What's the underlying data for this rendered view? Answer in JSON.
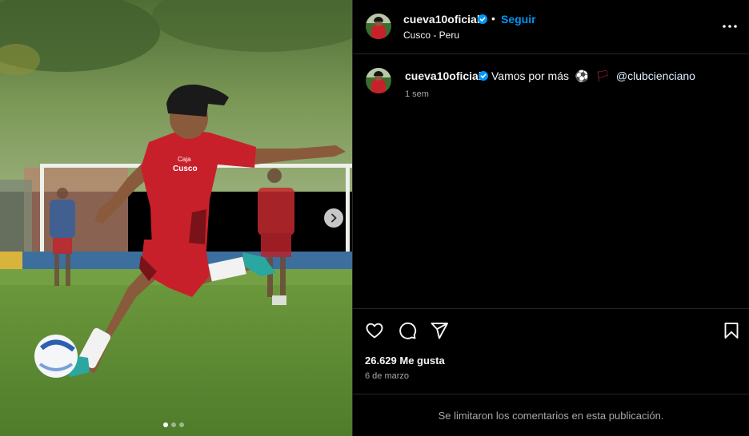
{
  "post": {
    "username": "cueva10oficial",
    "follow_label": "Seguir",
    "bullet": "•",
    "location": "Cusco - Peru",
    "caption": {
      "text": "Vamos por más",
      "emoji_ball": "⚽",
      "emoji_flag": "🏳",
      "mention": "@clubcienciano",
      "time_ago": "1 sem"
    },
    "likes": "26.629 Me gusta",
    "date": "6 de marzo",
    "comments_notice": "Se limitaron los comentarios en esta publicación.",
    "carousel": {
      "slide_count": 3,
      "active_index": 0
    },
    "jersey_text": {
      "line1": "Caja",
      "line2": "Cusco"
    }
  },
  "colors": {
    "background": "#000000",
    "follow_blue": "#0095f6",
    "verified_blue": "#0095f6",
    "divider": "#262626",
    "muted_text": "#a8a8a8",
    "jersey_red": "#c8202a"
  },
  "icons": {
    "verified": "verified-badge-icon",
    "more": "more-options-icon",
    "like": "heart-icon",
    "comment": "comment-icon",
    "share": "share-icon",
    "save": "bookmark-icon",
    "next": "chevron-right-icon"
  }
}
